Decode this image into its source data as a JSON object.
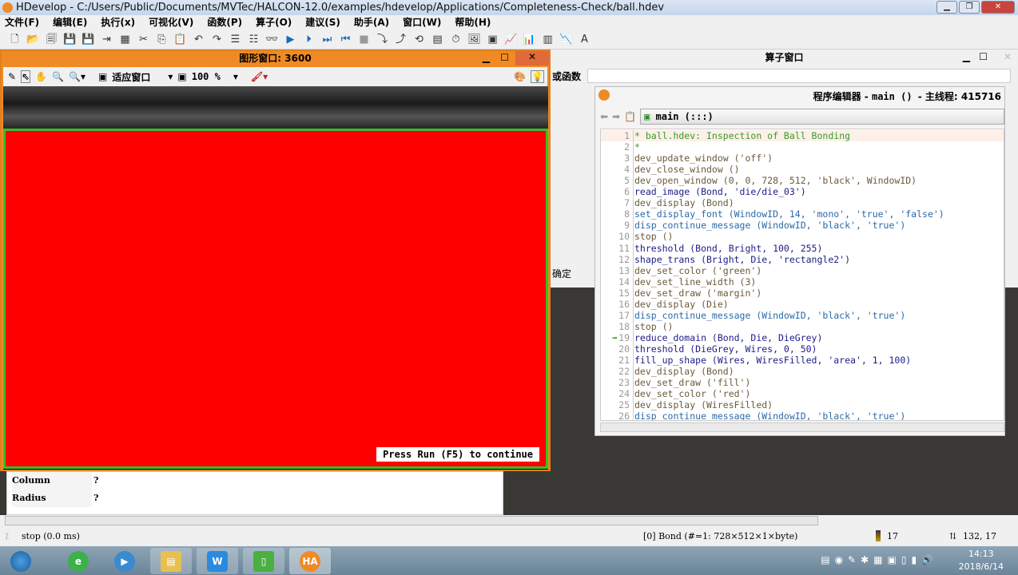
{
  "app": {
    "title": "HDevelop - C:/Users/Public/Documents/MVTec/HALCON-12.0/examples/hdevelop/Applications/Completeness-Check/ball.hdev"
  },
  "menu": [
    "文件(F)",
    "编辑(E)",
    "执行(x)",
    "可视化(V)",
    "函数(P)",
    "算子(O)",
    "建议(S)",
    "助手(A)",
    "窗口(W)",
    "帮助(H)"
  ],
  "graphics_window": {
    "title": "图形窗口: 3600",
    "fit_label": "适应窗口",
    "zoom": "100 %",
    "message": "Press Run (F5) to continue",
    "region_color": "#ff0000",
    "border_color": "#36c02a"
  },
  "operator_window": {
    "title": "算子窗口",
    "label": "或函数",
    "confirm": "确定"
  },
  "editor": {
    "title_prefix": "程序编辑器 - ",
    "title_proc": "main () ",
    "title_suffix": "- 主线程: 415716",
    "procedure": "main (:::)",
    "lines": [
      {
        "n": "1",
        "text": "* ball.hdev: Inspection of Ball Bonding",
        "kind": "com"
      },
      {
        "n": "2",
        "text": "*",
        "kind": "com"
      },
      {
        "n": "3",
        "text": "dev_update_window ('off')",
        "kind": "dev"
      },
      {
        "n": "4",
        "text": "dev_close_window ()",
        "kind": "dev"
      },
      {
        "n": "5",
        "text": "dev_open_window (0, 0, 728, 512, 'black', WindowID)",
        "kind": "dev"
      },
      {
        "n": "6",
        "text": "read_image (Bond, 'die/die_03')",
        "kind": "op"
      },
      {
        "n": "7",
        "text": "dev_display (Bond)",
        "kind": "dev"
      },
      {
        "n": "8",
        "text": "set_display_font (WindowID, 14, 'mono', 'true', 'false')",
        "kind": "disp"
      },
      {
        "n": "9",
        "text": "disp_continue_message (WindowID, 'black', 'true')",
        "kind": "disp"
      },
      {
        "n": "10",
        "text": "stop ()",
        "kind": "dev"
      },
      {
        "n": "11",
        "text": "threshold (Bond, Bright, 100, 255)",
        "kind": "op"
      },
      {
        "n": "12",
        "text": "shape_trans (Bright, Die, 'rectangle2')",
        "kind": "op"
      },
      {
        "n": "13",
        "text": "dev_set_color ('green')",
        "kind": "dev"
      },
      {
        "n": "14",
        "text": "dev_set_line_width (3)",
        "kind": "dev"
      },
      {
        "n": "15",
        "text": "dev_set_draw ('margin')",
        "kind": "dev"
      },
      {
        "n": "16",
        "text": "dev_display (Die)",
        "kind": "dev"
      },
      {
        "n": "17",
        "text": "disp_continue_message (WindowID, 'black', 'true')",
        "kind": "disp"
      },
      {
        "n": "18",
        "text": "stop ()",
        "kind": "dev"
      },
      {
        "n": "19",
        "text": "reduce_domain (Bond, Die, DieGrey)",
        "kind": "op"
      },
      {
        "n": "20",
        "text": "threshold (DieGrey, Wires, 0, 50)",
        "kind": "op"
      },
      {
        "n": "21",
        "text": "fill_up_shape (Wires, WiresFilled, 'area', 1, 100)",
        "kind": "op"
      },
      {
        "n": "22",
        "text": "dev_display (Bond)",
        "kind": "dev"
      },
      {
        "n": "23",
        "text": "dev_set_draw ('fill')",
        "kind": "dev"
      },
      {
        "n": "24",
        "text": "dev_set_color ('red')",
        "kind": "dev"
      },
      {
        "n": "25",
        "text": "dev_display (WiresFilled)",
        "kind": "dev"
      },
      {
        "n": "26",
        "text": "disp_continue_message (WindowID, 'black', 'true')",
        "kind": "disp"
      }
    ],
    "pc_line": "19"
  },
  "variables": [
    {
      "name": "Column",
      "value": "?"
    },
    {
      "name": "Radius",
      "value": "?"
    }
  ],
  "status": {
    "state": "stop (0.0 ms)",
    "image": "[0] Bond (#=1: 728×512×1×byte)",
    "gray": "17",
    "coords": "132, 17"
  },
  "taskbar": {
    "apps": [
      "ie",
      "video",
      "explorer",
      "wps",
      "app-green",
      "halcon"
    ],
    "time": "14:13",
    "date": "2018/6/14"
  }
}
